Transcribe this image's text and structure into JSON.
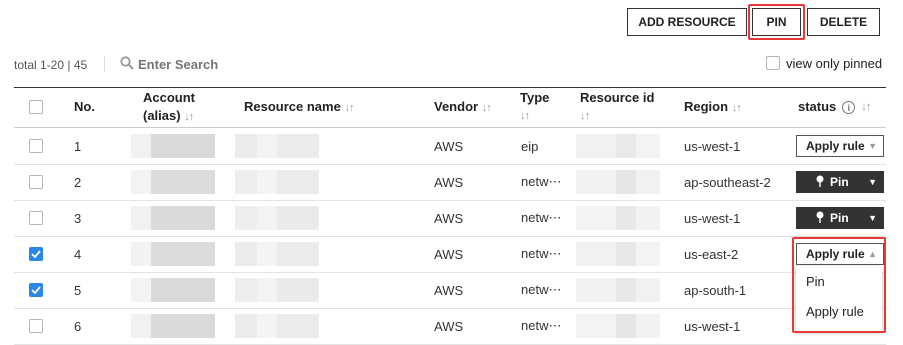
{
  "toolbar": {
    "add_resource": "ADD RESOURCE",
    "pin": "PIN",
    "delete": "DELETE"
  },
  "filter": {
    "total": "total 1-20 | 45",
    "search_placeholder": "Enter Search",
    "view_only_pinned": "view only pinned"
  },
  "table": {
    "headers": {
      "no": "No.",
      "account_line1": "Account",
      "account_line2": "(alias)",
      "resource_name": "Resource name",
      "vendor": "Vendor",
      "type": "Type",
      "resource_id": "Resource id",
      "region": "Region",
      "status": "status",
      "sort_glyph": "↓↑"
    },
    "rows": [
      {
        "no": "1",
        "vendor": "AWS",
        "type": "eip",
        "region": "us-west-1",
        "status": "Apply rule",
        "checked": false
      },
      {
        "no": "2",
        "vendor": "AWS",
        "type": "netw⋯",
        "region": "ap-southeast-2",
        "status": "Pin",
        "checked": false
      },
      {
        "no": "3",
        "vendor": "AWS",
        "type": "netw⋯",
        "region": "us-west-1",
        "status": "Pin",
        "checked": false
      },
      {
        "no": "4",
        "vendor": "AWS",
        "type": "netw⋯",
        "region": "us-east-2",
        "status": "Apply rule",
        "checked": true
      },
      {
        "no": "5",
        "vendor": "AWS",
        "type": "netw⋯",
        "region": "ap-south-1",
        "status": "",
        "checked": true
      },
      {
        "no": "6",
        "vendor": "AWS",
        "type": "netw⋯",
        "region": "us-west-1",
        "status": "",
        "checked": false
      }
    ]
  },
  "dropdown": {
    "options": [
      "Pin",
      "Apply rule"
    ]
  },
  "colors": {
    "highlight": "#e53935",
    "checkbox_checked": "#2a86e8",
    "pin_button_bg": "#333333"
  }
}
